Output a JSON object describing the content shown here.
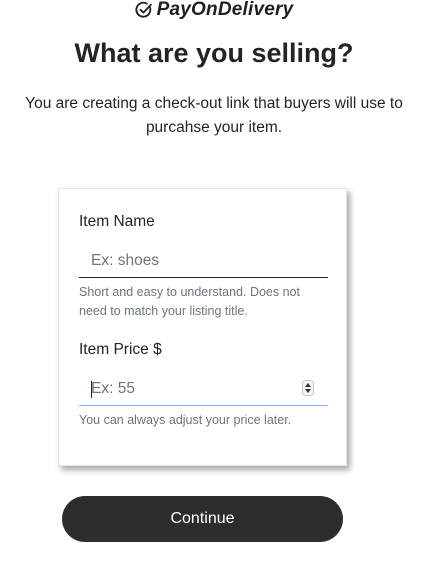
{
  "brand": {
    "name": "PayOnDelivery",
    "icon": "check-circle-icon"
  },
  "heading": "What are you selling?",
  "subheading": "You are creating a check-out link that buyers will use to purcahse your item.",
  "form": {
    "item_name": {
      "label": "Item Name",
      "placeholder": "Ex: shoes",
      "value": "",
      "help": "Short and easy to understand. Does not need to match your listing title."
    },
    "item_price": {
      "label": "Item Price $",
      "placeholder": "Ex: 55",
      "value": "",
      "help": "You can always adjust your price later."
    }
  },
  "continue_label": "Continue",
  "colors": {
    "button": "#2b2e31",
    "focus_border": "#86b7fe"
  }
}
